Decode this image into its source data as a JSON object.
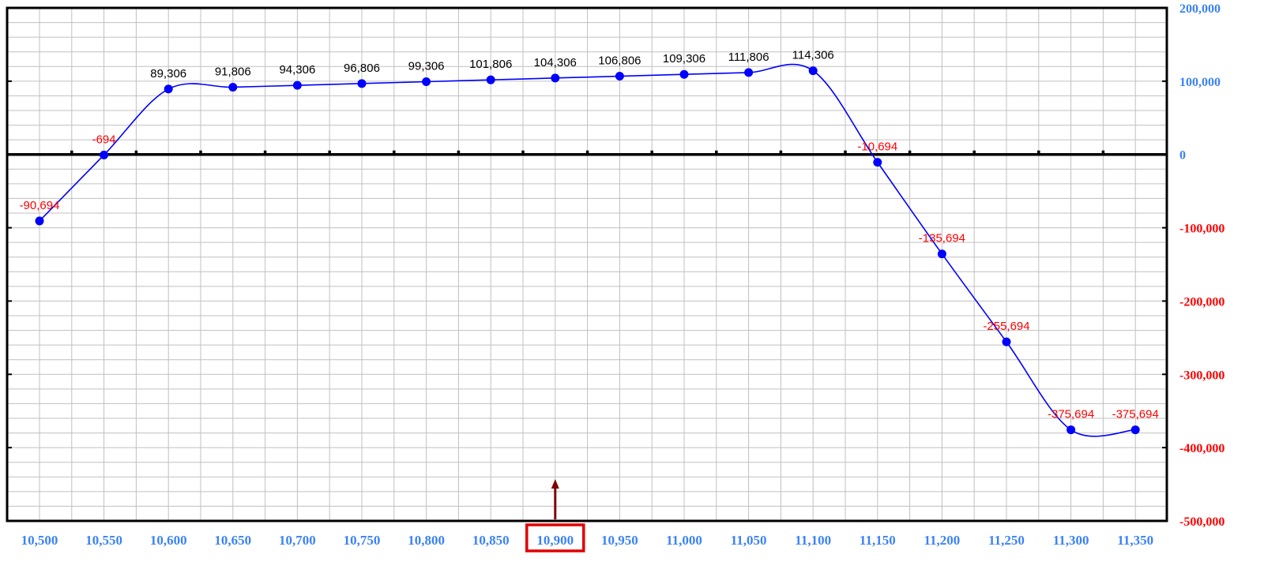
{
  "chart_data": {
    "type": "line",
    "title": "",
    "xlabel": "",
    "ylabel": "",
    "x": [
      10500,
      10550,
      10600,
      10650,
      10700,
      10750,
      10800,
      10850,
      10900,
      10950,
      11000,
      11050,
      11100,
      11150,
      11200,
      11250,
      11300,
      11350
    ],
    "x_tick_labels": [
      "10,500",
      "10,550",
      "10,600",
      "10,650",
      "10,700",
      "10,750",
      "10,800",
      "10,850",
      "10,900",
      "10,950",
      "11,000",
      "11,050",
      "11,100",
      "11,150",
      "11,200",
      "11,250",
      "11,300",
      "11,350"
    ],
    "series": [
      {
        "values": [
          -90694,
          -694,
          89306,
          91806,
          94306,
          96806,
          99306,
          101806,
          104306,
          106806,
          109306,
          111806,
          114306,
          -10694,
          -135694,
          -255694,
          -375694,
          -375694
        ],
        "labels": [
          "-90,694",
          "-694",
          "89,306",
          "91,806",
          "94,306",
          "96,806",
          "99,306",
          "101,806",
          "104,306",
          "106,806",
          "109,306",
          "111,806",
          "114,306",
          "-10,694",
          "-135,694",
          "-255,694",
          "-375,694",
          "-375,694"
        ],
        "color": "#0000ff"
      }
    ],
    "ylim": [
      -500000,
      200000
    ],
    "y_ticks": [
      200000,
      100000,
      0,
      -100000,
      -200000,
      -300000,
      -400000,
      -500000
    ],
    "y_tick_labels": [
      "200,000",
      "100,000",
      "0",
      "-100,000",
      "-200,000",
      "-300,000",
      "-400,000",
      "-500,000"
    ],
    "y_axis_position": "right",
    "grid": true,
    "highlight_x": 10900,
    "colors": {
      "line": "#0000ff",
      "positive_label": "#000000",
      "negative_label": "#ff0000",
      "x_tick": "#3b82f6",
      "y_tick_positive": "#3b82f6",
      "y_tick_negative": "#ff0000",
      "highlight_box": "#e00000",
      "marker_arrow": "#800000",
      "grid": "#c0c0c0"
    }
  }
}
